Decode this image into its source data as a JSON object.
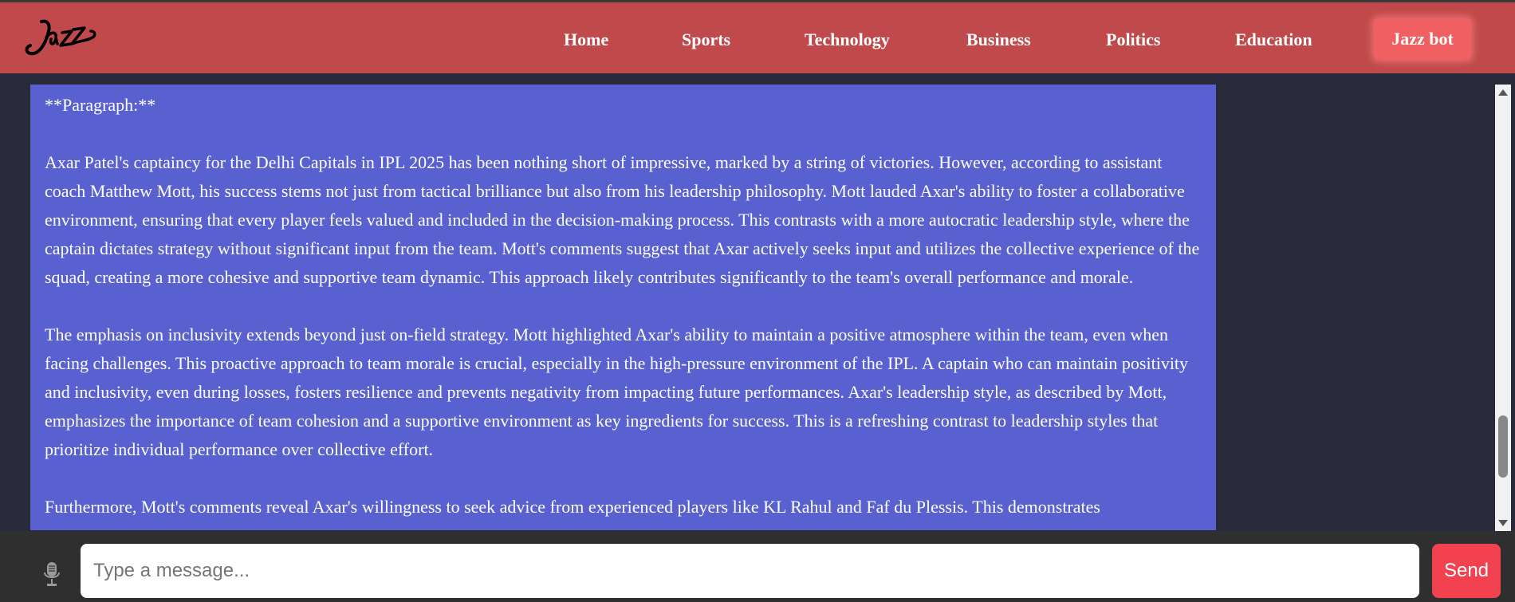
{
  "brand": {
    "logo_text": "Jazz"
  },
  "nav": {
    "items": [
      {
        "label": "Home"
      },
      {
        "label": "Sports"
      },
      {
        "label": "Technology"
      },
      {
        "label": "Business"
      },
      {
        "label": "Politics"
      },
      {
        "label": "Education"
      }
    ],
    "cta_label": "Jazz bot"
  },
  "message": {
    "heading": "**Paragraph:**",
    "paragraphs": [
      "Axar Patel's captaincy for the Delhi Capitals in IPL 2025 has been nothing short of impressive, marked by a string of victories. However, according to assistant coach Matthew Mott, his success stems not just from tactical brilliance but also from his leadership philosophy. Mott lauded Axar's ability to foster a collaborative environment, ensuring that every player feels valued and included in the decision-making process. This contrasts with a more autocratic leadership style, where the captain dictates strategy without significant input from the team. Mott's comments suggest that Axar actively seeks input and utilizes the collective experience of the squad, creating a more cohesive and supportive team dynamic. This approach likely contributes significantly to the team's overall performance and morale.",
      "The emphasis on inclusivity extends beyond just on-field strategy. Mott highlighted Axar's ability to maintain a positive atmosphere within the team, even when facing challenges. This proactive approach to team morale is crucial, especially in the high-pressure environment of the IPL. A captain who can maintain positivity and inclusivity, even during losses, fosters resilience and prevents negativity from impacting future performances. Axar's leadership style, as described by Mott, emphasizes the importance of team cohesion and a supportive environment as key ingredients for success. This is a refreshing contrast to leadership styles that prioritize individual performance over collective effort.",
      "Furthermore, Mott's comments reveal Axar's willingness to seek advice from experienced players like KL Rahul and Faf du Plessis. This demonstrates"
    ]
  },
  "composer": {
    "placeholder": "Type a message...",
    "send_label": "Send",
    "mic_icon": "microphone-icon"
  },
  "colors": {
    "navbar": "#c04a4b",
    "message_bg": "#5861cf",
    "page_bg": "#282a3a",
    "send": "#f2414f",
    "cta": "#f05f62"
  }
}
